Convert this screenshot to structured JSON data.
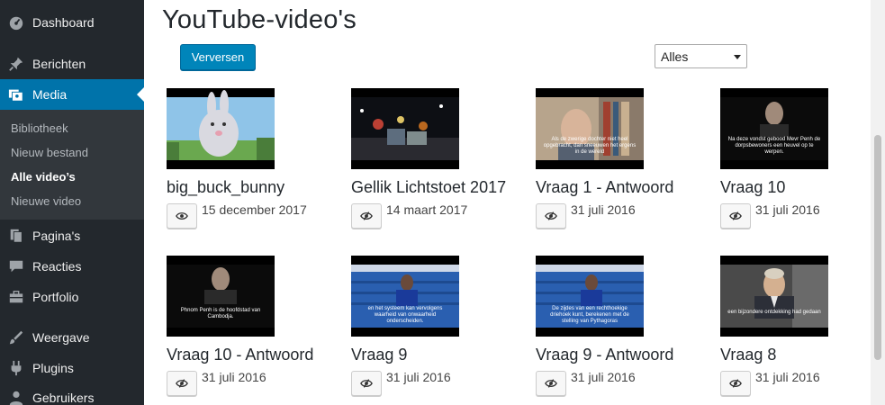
{
  "sidebar": {
    "items": [
      {
        "label": "Dashboard",
        "icon": "dashboard-icon"
      },
      {
        "label": "Berichten",
        "icon": "pin-icon"
      },
      {
        "label": "Media",
        "icon": "media-icon"
      },
      {
        "label": "Pagina's",
        "icon": "pages-icon"
      },
      {
        "label": "Reacties",
        "icon": "comments-icon"
      },
      {
        "label": "Portfolio",
        "icon": "portfolio-icon"
      },
      {
        "label": "Weergave",
        "icon": "appearance-icon"
      },
      {
        "label": "Plugins",
        "icon": "plugins-icon"
      },
      {
        "label": "Gebruikers",
        "icon": "users-icon"
      }
    ],
    "submenu": [
      {
        "label": "Bibliotheek"
      },
      {
        "label": "Nieuw bestand"
      },
      {
        "label": "Alle video’s"
      },
      {
        "label": "Nieuwe video"
      }
    ],
    "active_color": "#0073aa"
  },
  "page": {
    "title": "YouTube-video's",
    "refresh_label": "Verversen",
    "filter_value": "Alles"
  },
  "videos": [
    {
      "title": "big_buck_bunny",
      "date": "15 december 2017",
      "visible": true,
      "thumb": "bunny"
    },
    {
      "title": "Gellik Lichtstoet 2017",
      "date": "14 maart 2017",
      "visible": false,
      "thumb": "parade"
    },
    {
      "title": "Vraag 1 - Antwoord",
      "date": "31 juli 2016",
      "visible": false,
      "thumb": "man-books",
      "caption": "Als de zwerige dochter niet heel opgebracht, dan sneeuwen het ergens in de wereld"
    },
    {
      "title": "Vraag 10",
      "date": "31 juli 2016",
      "visible": false,
      "thumb": "man-dark",
      "caption": "Na deze vondst gebood Mevr Penh de dorpsbewoners een heuvel op te werpen."
    },
    {
      "title": "Vraag 10 - Antwoord",
      "date": "31 juli 2016",
      "visible": false,
      "thumb": "man-dark",
      "caption": "Phnom Penh is de hoofdstad van Cambodja."
    },
    {
      "title": "Vraag 9",
      "date": "31 juli 2016",
      "visible": false,
      "thumb": "stadium",
      "caption": "en het systeem kan vervolgens waarheid van onwaarheid onderscheiden."
    },
    {
      "title": "Vraag 9 - Antwoord",
      "date": "31 juli 2016",
      "visible": false,
      "thumb": "stadium",
      "caption": "De zijdes van een rechthoekige driehoek kunt, berekenen met de stelling van Pythagoras"
    },
    {
      "title": "Vraag 8",
      "date": "31 juli 2016",
      "visible": false,
      "thumb": "man-suit",
      "caption": "een bijzondere ontdekking had gedaan"
    }
  ]
}
